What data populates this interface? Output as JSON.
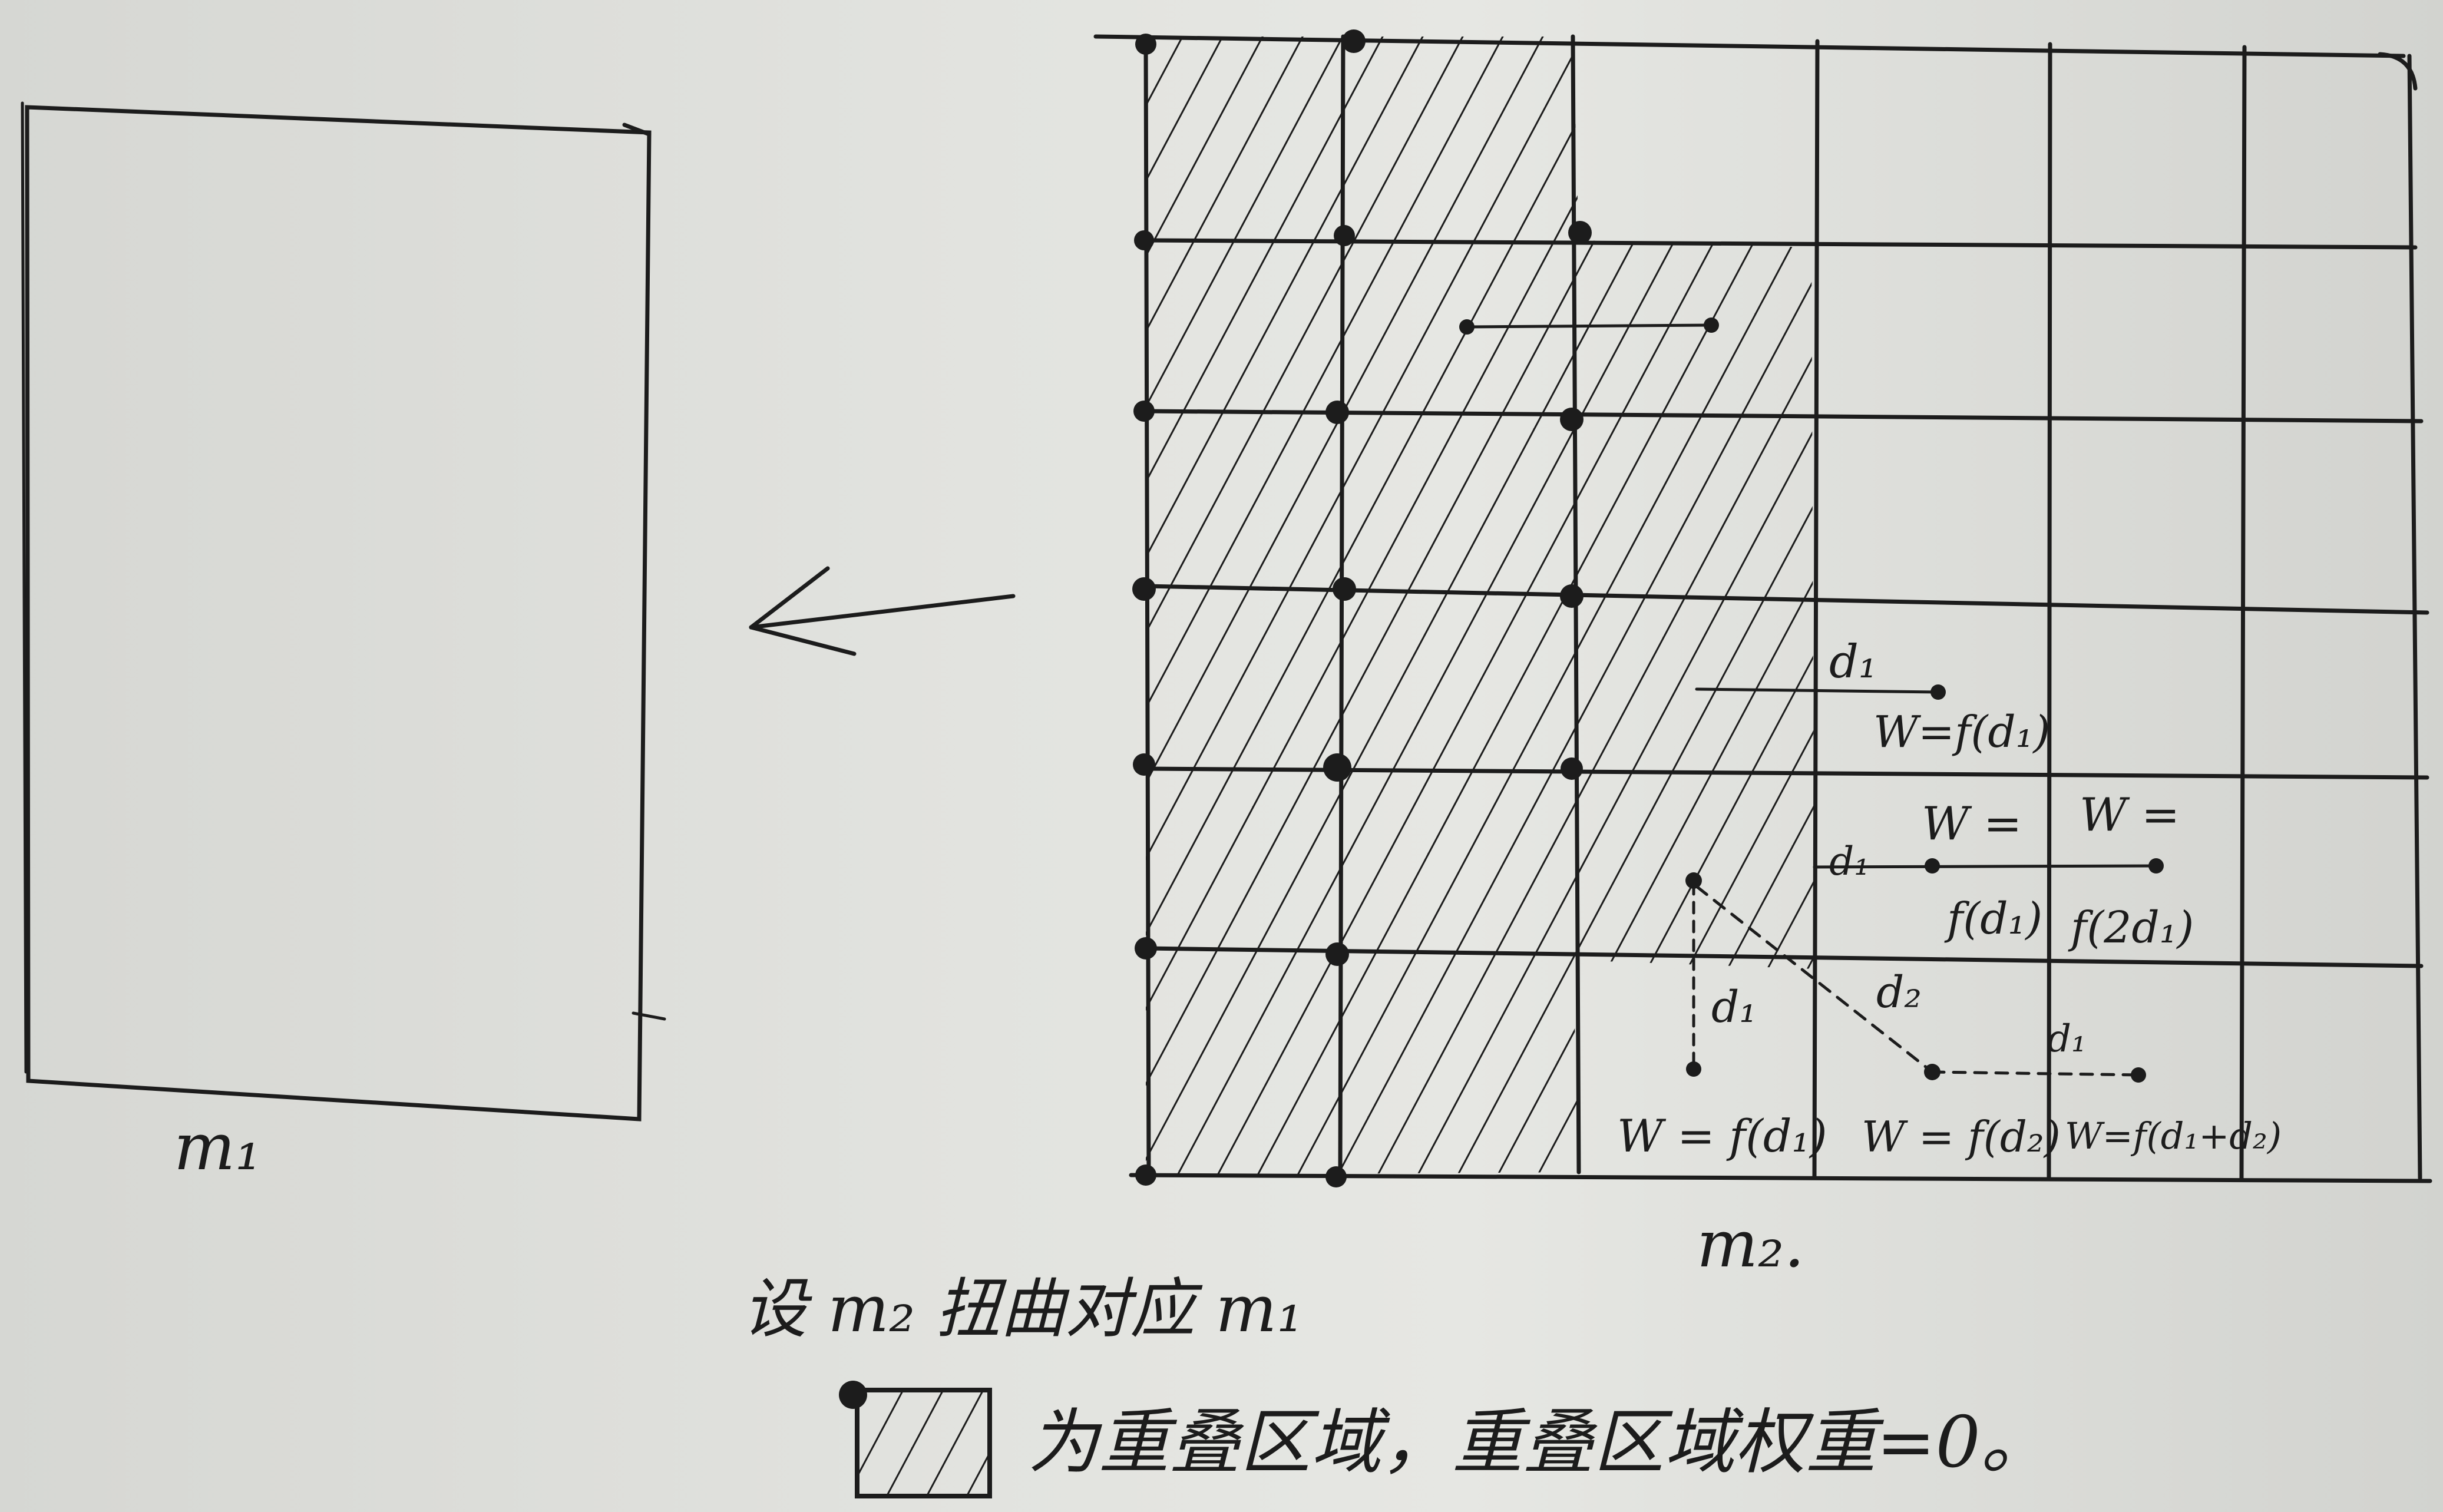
{
  "labels": {
    "m1": "m₁",
    "m2": "m₂.",
    "d1": "d₁",
    "d2": "d₂",
    "w_eq": "W =",
    "w_fd1": "W = f(d₁)",
    "w_fd1_top": "W=f(d₁)",
    "f_d1": "f(d₁)",
    "f_2d1": "f(2d₁)",
    "w_fd2": "W = f(d₂)",
    "w_fd1d2": "W=f(d₁+d₂)"
  },
  "caption": {
    "line1": "设 m₂ 扭曲对应 m₁",
    "line2": "为重叠区域，重叠区域权重=0。"
  },
  "colors": {
    "ink": "#1c1c1c",
    "paper": "#e2e3df"
  }
}
